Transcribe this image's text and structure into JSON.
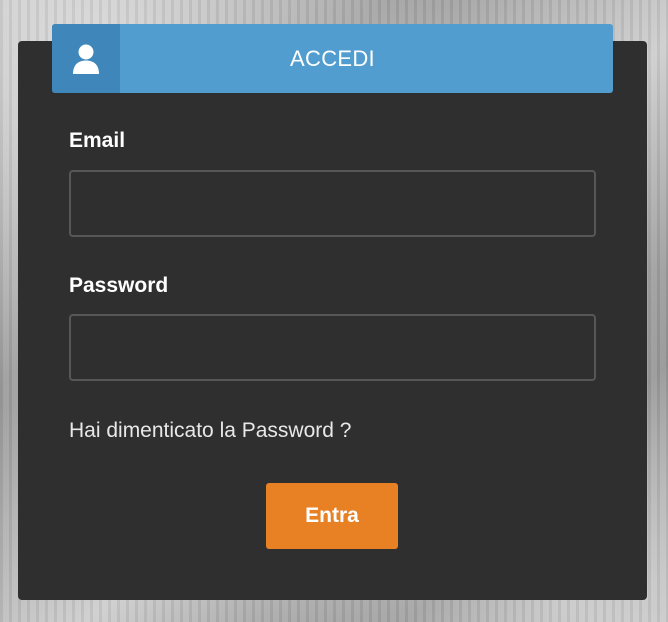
{
  "login": {
    "title": "ACCEDI",
    "user_icon": "user-icon",
    "email_label": "Email",
    "email_value": "",
    "password_label": "Password",
    "password_value": "",
    "forgot_link": "Hai dimenticato la Password ?",
    "submit_label": "Entra"
  },
  "colors": {
    "panel_bg": "#2f2f2f",
    "header_bg": "#529dd0",
    "header_icon_bg": "#3f86bb",
    "button_bg": "#e88124",
    "field_border": "#575757"
  }
}
